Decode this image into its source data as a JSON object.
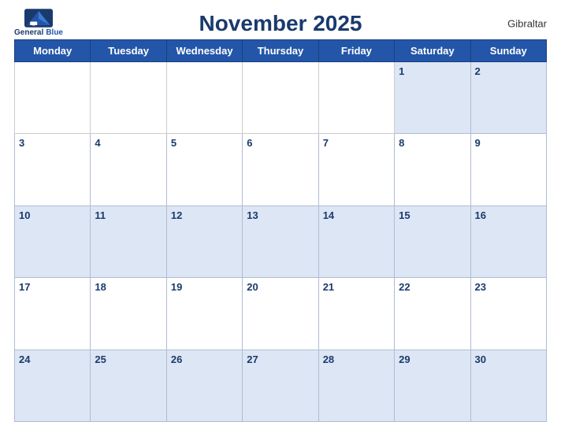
{
  "header": {
    "logo_general": "General",
    "logo_blue": "Blue",
    "title": "November 2025",
    "country": "Gibraltar"
  },
  "weekdays": [
    "Monday",
    "Tuesday",
    "Wednesday",
    "Thursday",
    "Friday",
    "Saturday",
    "Sunday"
  ],
  "weeks": [
    [
      null,
      null,
      null,
      null,
      null,
      1,
      2
    ],
    [
      3,
      4,
      5,
      6,
      7,
      8,
      9
    ],
    [
      10,
      11,
      12,
      13,
      14,
      15,
      16
    ],
    [
      17,
      18,
      19,
      20,
      21,
      22,
      23
    ],
    [
      24,
      25,
      26,
      27,
      28,
      29,
      30
    ]
  ]
}
